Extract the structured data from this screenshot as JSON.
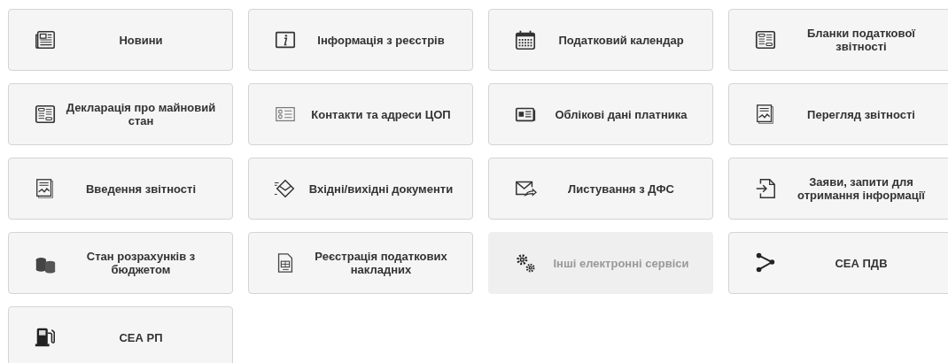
{
  "tiles": [
    {
      "label": "Новини",
      "disabled": false
    },
    {
      "label": "Інформація з реєстрів",
      "disabled": false
    },
    {
      "label": "Податковий календар",
      "disabled": false
    },
    {
      "label": "Бланки податкової звітності",
      "disabled": false
    },
    {
      "label": "Декларація про майновий стан",
      "disabled": false
    },
    {
      "label": "Контакти та адреси ЦОП",
      "disabled": false
    },
    {
      "label": "Облікові дані платника",
      "disabled": false
    },
    {
      "label": "Перегляд звітності",
      "disabled": false
    },
    {
      "label": "Введення звітності",
      "disabled": false
    },
    {
      "label": "Вхідні/вихідні документи",
      "disabled": false
    },
    {
      "label": "Листування з ДФС",
      "disabled": false
    },
    {
      "label": "Заяви, запити для отримання інформації",
      "disabled": false
    },
    {
      "label": "Стан розрахунків з бюджетом",
      "disabled": false
    },
    {
      "label": "Реєстрація податкових накладних",
      "disabled": false
    },
    {
      "label": "Інші електронні сервіси",
      "disabled": true
    },
    {
      "label": "СЕА ПДВ",
      "disabled": false
    },
    {
      "label": "СЕА РП",
      "disabled": false
    }
  ]
}
